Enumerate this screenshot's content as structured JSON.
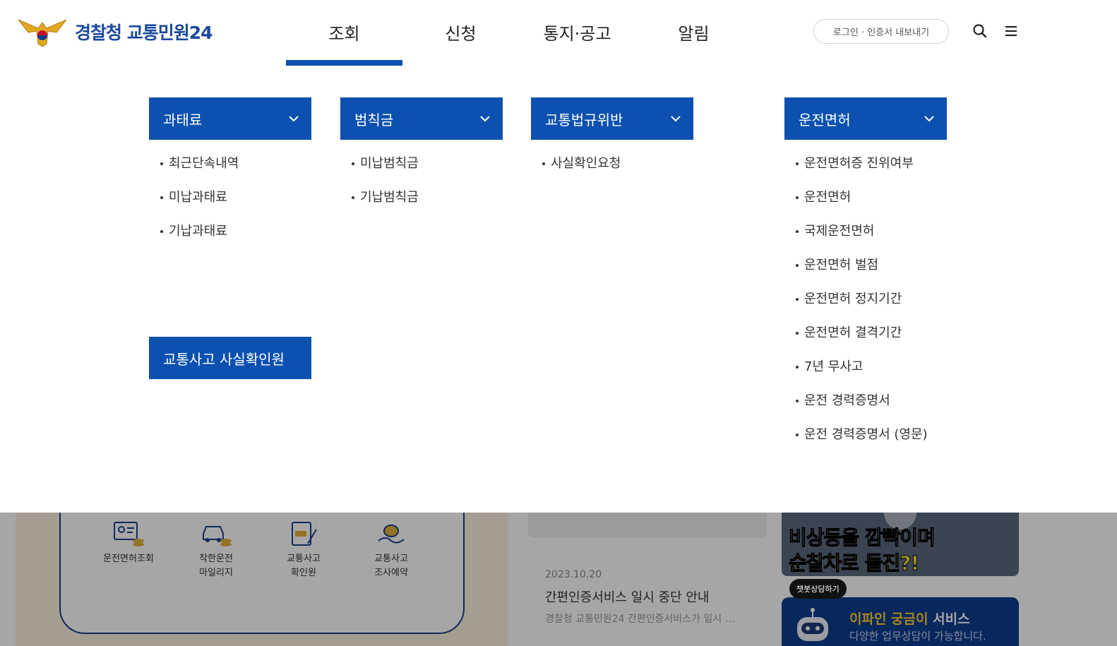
{
  "header": {
    "logo_text": "경찰청 교통민원24",
    "nav": [
      "조회",
      "신청",
      "통지·공고",
      "알림"
    ],
    "login_label": "로그인 · 인증서 내보내기",
    "icons": [
      "search-icon",
      "menu-icon"
    ]
  },
  "mega": {
    "columns": [
      {
        "title": "과태료",
        "items": [
          "최근단속내역",
          "미납과태료",
          "기납과태료"
        ]
      },
      {
        "title": "범칙금",
        "items": [
          "미납범칙금",
          "기납범칙금"
        ]
      },
      {
        "title": "교통법규위반",
        "items": [
          "사실확인요청"
        ]
      },
      {
        "title": "운전면허",
        "items": [
          "운전면허증 진위여부",
          "운전면허",
          "국제운전면허",
          "운전면허 벌점",
          "운전면허 정지기간",
          "운전면허 결격기간",
          "7년 무사고",
          "운전 경력증명서",
          "운전 경력증명서 (영문)"
        ]
      }
    ],
    "special_button": "교통사고 사실확인원"
  },
  "background": {
    "quick_links": [
      {
        "line1": "운전면허조회",
        "line2": ""
      },
      {
        "line1": "착한운전",
        "line2": "마일리지"
      },
      {
        "line1": "교통사고",
        "line2": "확인원"
      },
      {
        "line1": "교통사고",
        "line2": "조사예약"
      }
    ],
    "news": {
      "date": "2023.10.20",
      "title": "간편인증서비스 일시 중단 안내",
      "desc": "경찰청 교통민원24 간편인증서비스가 일시 …"
    },
    "video": {
      "line1": "비상등을 깜빡이며",
      "line2": "순찰차로 돌진?!"
    },
    "chat": {
      "bubble": "챗봇상담하기",
      "title_hl": "이파인 궁금이",
      "title_rest": " 서비스",
      "sub": "다양한 업무상담이 가능합니다."
    }
  },
  "colors": {
    "primary": "#0d51b0",
    "navy": "#1b4a9c"
  }
}
